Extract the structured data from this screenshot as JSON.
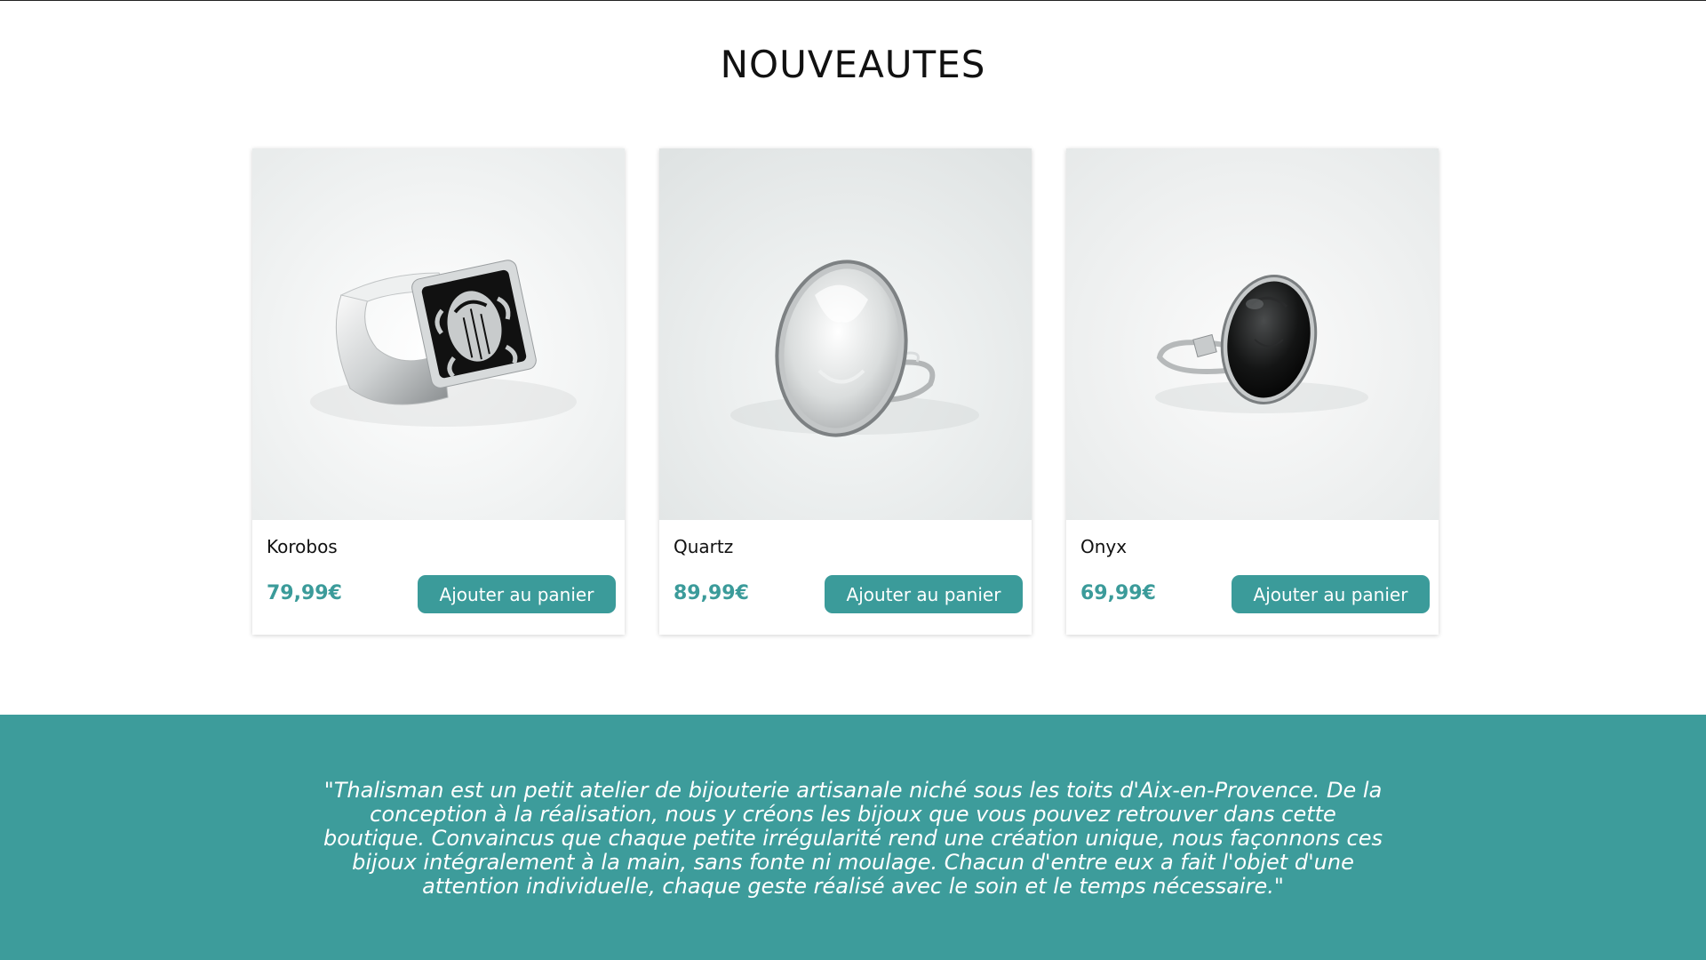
{
  "section": {
    "title": "NOUVEAUTES"
  },
  "products": [
    {
      "name": "Korobos",
      "price": "79,99€",
      "button_label": "Ajouter au panier",
      "image": "silver-scarab-signet-ring"
    },
    {
      "name": "Quartz",
      "price": "89,99€",
      "button_label": "Ajouter au panier",
      "image": "clear-quartz-oval-ring"
    },
    {
      "name": "Onyx",
      "price": "69,99€",
      "button_label": "Ajouter au panier",
      "image": "black-onyx-oval-ring"
    }
  ],
  "footer_band": {
    "quote": "\"Thalisman est un petit atelier de bijouterie artisanale niché sous les toits d'Aix-en-Provence. De la conception à la réalisation, nous y créons les bijoux que vous pouvez retrouver dans cette boutique. Convaincus que chaque petite irrégularité rend une création unique, nous façonnons ces bijoux intégralement à la main, sans fonte ni moulage. Chacun d'entre eux a fait l'objet d'une attention individuelle, chaque geste réalisé avec le soin et le temps nécessaire.\""
  },
  "colors": {
    "accent": "#3b9b9a",
    "band": "#3d9c9b",
    "text": "#111111"
  }
}
